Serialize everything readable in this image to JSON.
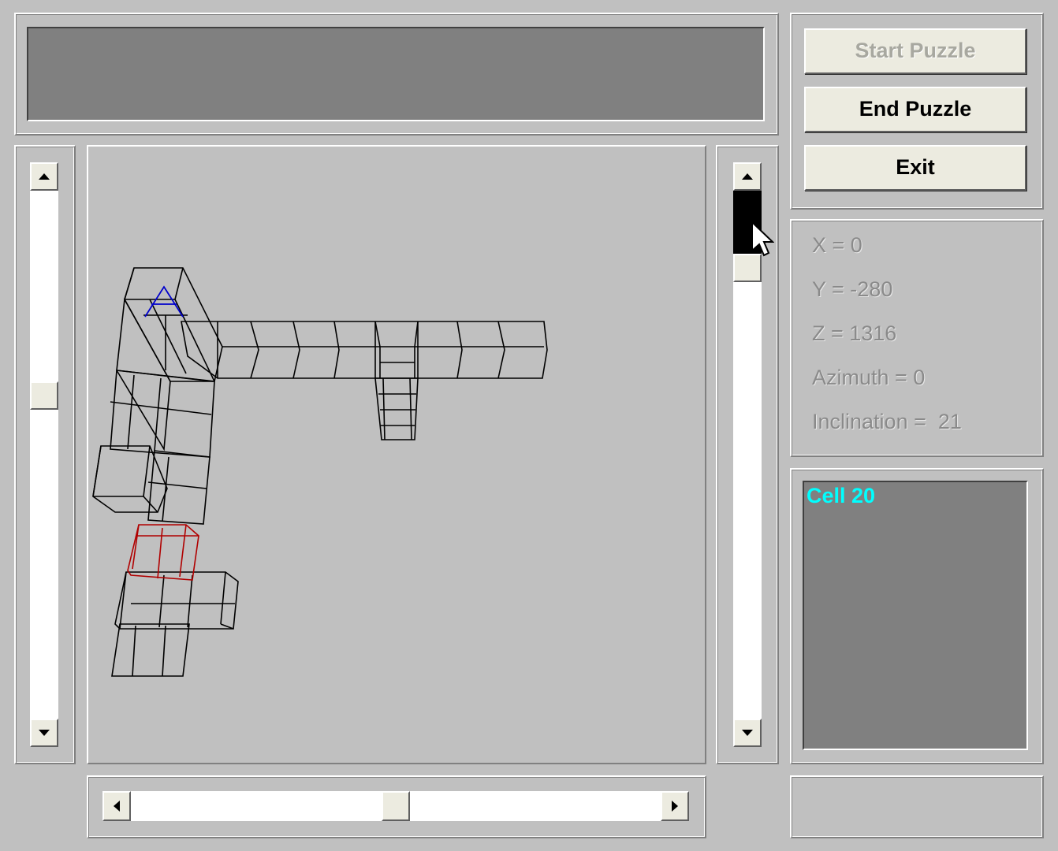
{
  "buttons": {
    "start": "Start Puzzle",
    "end": "End Puzzle",
    "exit": "Exit"
  },
  "status": {
    "x": "X = 0",
    "y": "Y = -280",
    "z": "Z = 1316",
    "azimuth": "Azimuth = 0",
    "inclination": "Inclination =  21"
  },
  "cell_label": "Cell 20",
  "colors": {
    "cell_label": "#00ffff",
    "selected_cell": "#c00000",
    "start_marker": "#0000cc",
    "wireframe": "#000000"
  },
  "scrollbars": {
    "left_vertical": 0.43,
    "right_vertical": 0.16,
    "bottom_horizontal": 0.5
  }
}
